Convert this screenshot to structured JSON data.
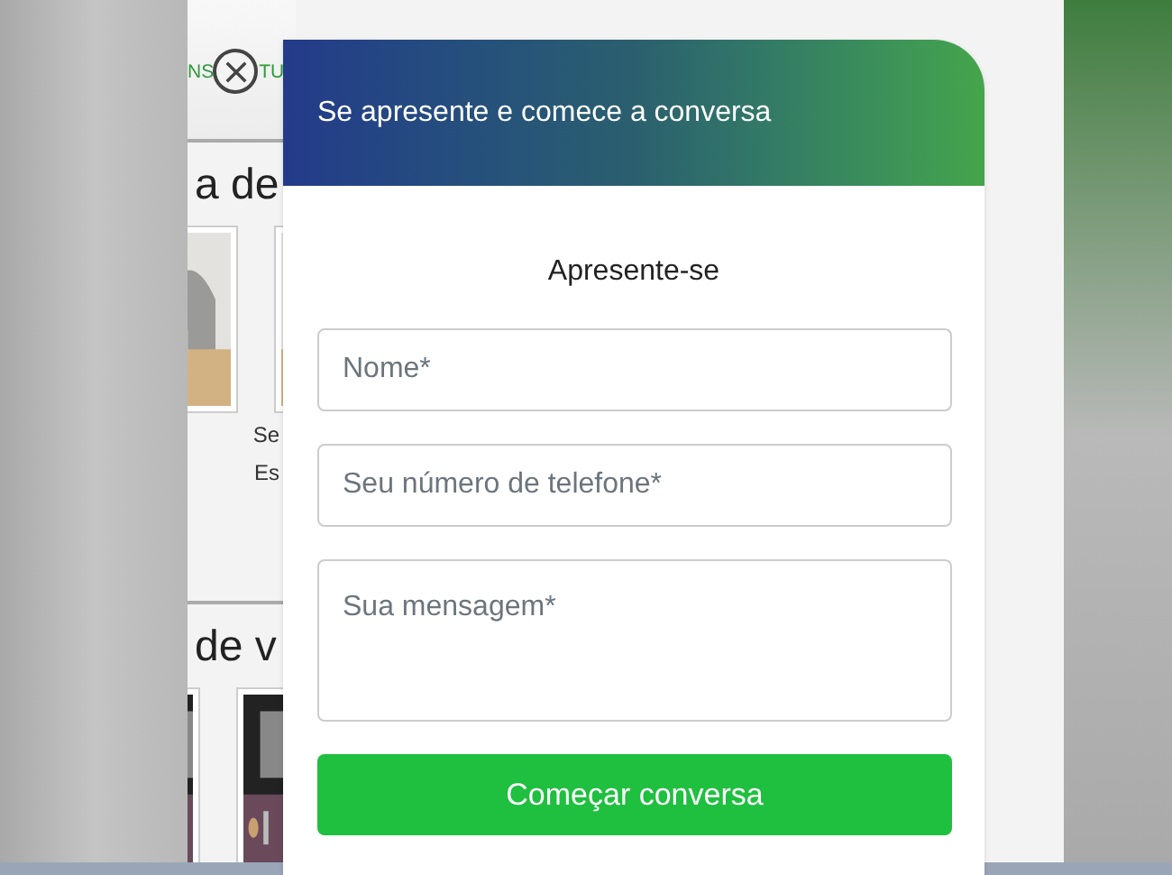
{
  "page": {
    "nav_texts": [
      "NS",
      "TU"
    ],
    "sections": [
      {
        "heading": "a de",
        "captions": [
          "Se",
          "Es"
        ]
      },
      {
        "heading": "de v"
      }
    ]
  },
  "chat": {
    "title": "Se apresente e comece a conversa",
    "intro": "Apresente-se",
    "fields": [
      {
        "kind": "input",
        "placeholder": "Nome*"
      },
      {
        "kind": "input",
        "placeholder": "Seu número de telefone*"
      },
      {
        "kind": "textarea",
        "placeholder": "Sua mensagem*"
      }
    ],
    "submit": "Começar conversa"
  }
}
